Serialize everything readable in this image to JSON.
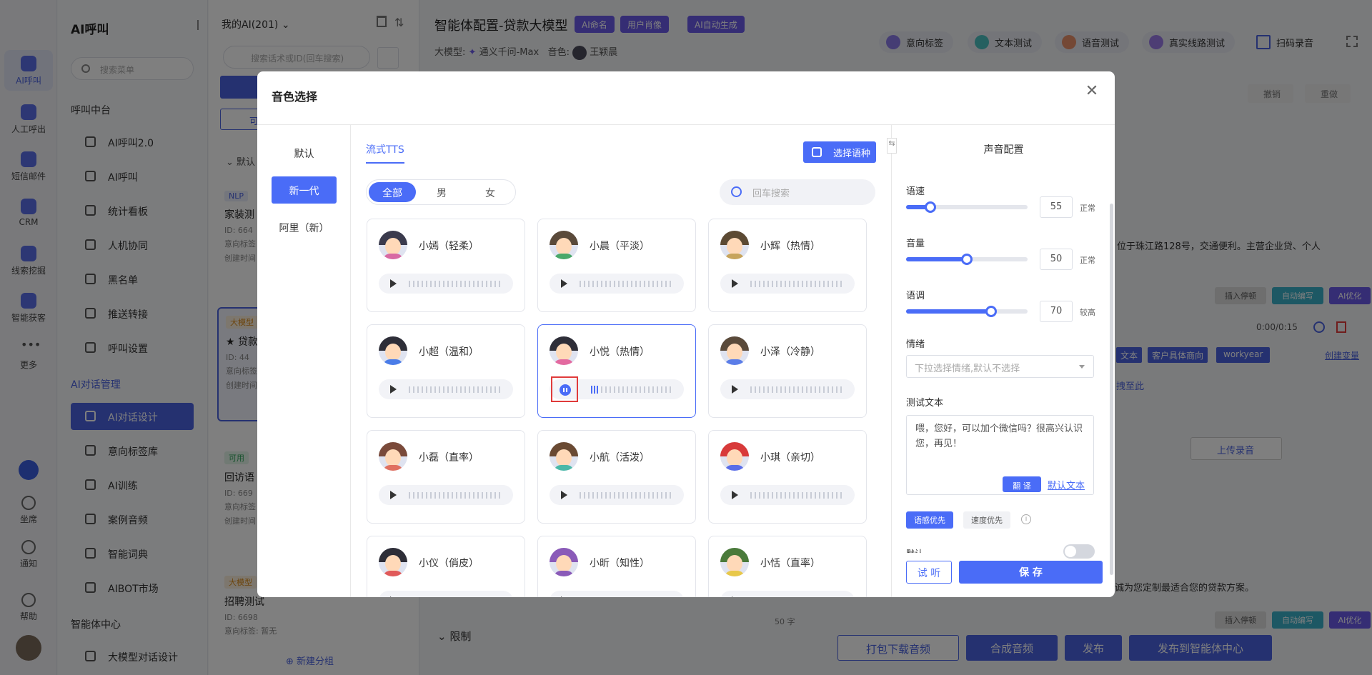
{
  "rail": {
    "items": [
      {
        "label": "AI呼叫",
        "icon": "phone-icon",
        "active": true
      },
      {
        "label": "人工呼出",
        "icon": "headset-icon"
      },
      {
        "label": "短信邮件",
        "icon": "message-icon"
      },
      {
        "label": "CRM",
        "icon": "crm-icon"
      },
      {
        "label": "线索挖掘",
        "icon": "clue-icon"
      },
      {
        "label": "智能获客",
        "icon": "target-icon"
      },
      {
        "label": "更多",
        "icon": "more-icon"
      }
    ],
    "bottom": [
      {
        "label": "坐席",
        "icon": "agent-icon"
      },
      {
        "label": "通知",
        "icon": "bell-icon"
      },
      {
        "label": "帮助",
        "icon": "help-icon"
      }
    ]
  },
  "menu": {
    "title": "AI呼叫",
    "search_placeholder": "搜索菜单",
    "section1": "呼叫中台",
    "items1": [
      "AI呼叫2.0",
      "AI呼叫",
      "统计看板",
      "人机协同",
      "黑名单",
      "推送转接",
      "呼叫设置"
    ],
    "section2": "AI对话管理",
    "items2": [
      "AI对话设计",
      "意向标签库",
      "AI训练",
      "案例音频",
      "智能词典",
      "AIBOT市场"
    ],
    "section3": "智能体中心",
    "items3": [
      "大模型对话设计"
    ]
  },
  "list": {
    "title": "我的AI(201)",
    "search_placeholder": "搜索话术或ID(回车搜索)",
    "new_group": "新建分组",
    "cards": [
      {
        "tag": "NLP",
        "name": "家装测",
        "id": "ID: 664",
        "line1": "意向标签",
        "line2": "创建时间"
      },
      {
        "tag": "大模型",
        "name": "贷款",
        "id": "ID: 44",
        "line1": "意向标签",
        "line2": "创建时间"
      },
      {
        "tag": "可用",
        "name": "回访语",
        "id": "ID: 669",
        "line1": "意向标签",
        "line2": "创建时间"
      },
      {
        "tag": "大模型",
        "name": "招聘测试",
        "id": "ID: 6698",
        "line1": "意向标签: 暂无"
      }
    ],
    "collapse_label": "默认",
    "button_label": "可"
  },
  "main": {
    "title": "智能体配置-贷款大模型",
    "tags": [
      "AI命名",
      "用户肖像",
      "AI自动生成"
    ],
    "model_label": "大模型:",
    "model_value": "通义千问-Max",
    "voice_label": "音色:",
    "voice_value": "王颖晨",
    "tools": [
      "意向标签",
      "文本测试",
      "语音测试",
      "真实线路测试",
      "扫码录音"
    ],
    "undo": "撤销",
    "redo": "重做",
    "text_snippet": "，位于珠江路128号，交通便利。主营企业贷、个人",
    "insert_pause": "插入停顿",
    "auto_write": "自动编写",
    "ai_opt": "AI优化",
    "time": "0:00/0:15",
    "var_tags": [
      "文本",
      "客户具体商向",
      "workyear"
    ],
    "create_var": "创建变量",
    "drag_here": "拽至此",
    "upload": "上传录音",
    "text_snippet2": "诚为您定制最适合您的贷款方案。",
    "word_count": "50 字",
    "limit": "限制",
    "footer": [
      "打包下载音频",
      "合成音频",
      "发布",
      "发布到智能体中心"
    ]
  },
  "modal": {
    "title": "音色选择",
    "categories": [
      "默认",
      "新一代",
      "阿里（新）"
    ],
    "active_category": 1,
    "tab": "流式TTS",
    "lang_button": "选择语种",
    "genders": [
      "全部",
      "男",
      "女"
    ],
    "search_placeholder": "回车搜索",
    "voices": [
      {
        "name": "小嫣（轻柔）",
        "hair": "#3b3b4d",
        "body": "#d86aa3"
      },
      {
        "name": "小晨（平淡）",
        "hair": "#5a4a3a",
        "body": "#4aa86a"
      },
      {
        "name": "小辉（热情）",
        "hair": "#5c4a33",
        "body": "#c7a45c"
      },
      {
        "name": "小超（温和）",
        "hair": "#2e2e38",
        "body": "#4a7ce8"
      },
      {
        "name": "小悦（热情）",
        "hair": "#2e2e38",
        "body": "#e36aa0",
        "playing": true
      },
      {
        "name": "小泽（冷静）",
        "hair": "#5a4a3a",
        "body": "#5b7de8"
      },
      {
        "name": "小磊（直率）",
        "hair": "#7a4a3a",
        "body": "#e07060"
      },
      {
        "name": "小航（活泼）",
        "hair": "#6a4a33",
        "body": "#4ab8a8"
      },
      {
        "name": "小琪（亲切）",
        "hair": "#d83a3a",
        "body": "#5b6ee8"
      },
      {
        "name": "小仪（俏皮）",
        "hair": "#2e2e38",
        "body": "#e05a5a"
      },
      {
        "name": "小昕（知性）",
        "hair": "#8a5ab8",
        "body": "#8a5ab8"
      },
      {
        "name": "小恬（直率）",
        "hair": "#4a7a3a",
        "body": "#e8c84a"
      }
    ],
    "config": {
      "title": "声音配置",
      "speed_label": "语速",
      "speed_value": "55",
      "speed_level": "正常",
      "volume_label": "音量",
      "volume_value": "50",
      "volume_level": "正常",
      "pitch_label": "语调",
      "pitch_value": "70",
      "pitch_level": "较高",
      "emotion_label": "情绪",
      "emotion_placeholder": "下拉选择情绪,默认不选择",
      "test_label": "测试文本",
      "test_text": "喂，您好，可以加个微信吗？很高兴认识您，再见！",
      "translate": "翻 译",
      "default_text": "默认文本",
      "prio_quality": "语感优先",
      "prio_speed": "速度优先",
      "toggle_label": "默认",
      "listen": "试 听",
      "save": "保 存"
    },
    "levels": {
      "speed": 0.2,
      "volume": 0.5,
      "pitch": 0.7
    }
  }
}
